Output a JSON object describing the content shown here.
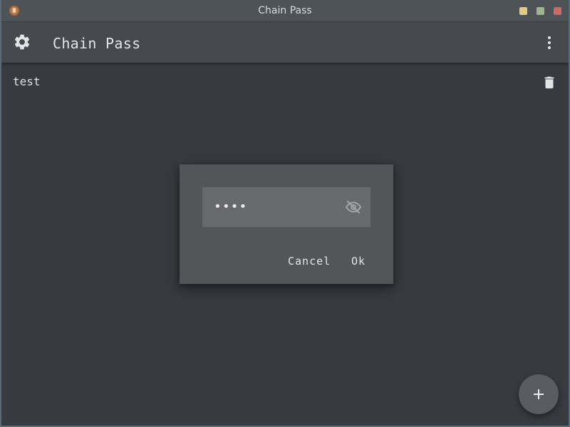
{
  "window": {
    "title": "Chain Pass",
    "controls": {
      "minimize": "minimize-button",
      "maximize": "maximize-button",
      "close": "close-button"
    },
    "colors": {
      "minimize": "#e2c98c",
      "maximize": "#9fb591",
      "close": "#c96a6b"
    }
  },
  "appbar": {
    "title": "Chain Pass",
    "left_icon": "gear-icon",
    "right_icon": "more-vertical-icon"
  },
  "list": {
    "items": [
      {
        "label": "test",
        "action_icon": "trash-icon"
      }
    ]
  },
  "dialog": {
    "password_value": "••••",
    "visibility_icon": "eye-off-icon",
    "cancel_label": "Cancel",
    "ok_label": "Ok"
  },
  "fab": {
    "icon": "plus-icon"
  },
  "theme": {
    "background": "#373b3f",
    "appbar": "#46494d",
    "dialog": "#535659",
    "field": "#67696c",
    "text": "#e3e4e6"
  }
}
